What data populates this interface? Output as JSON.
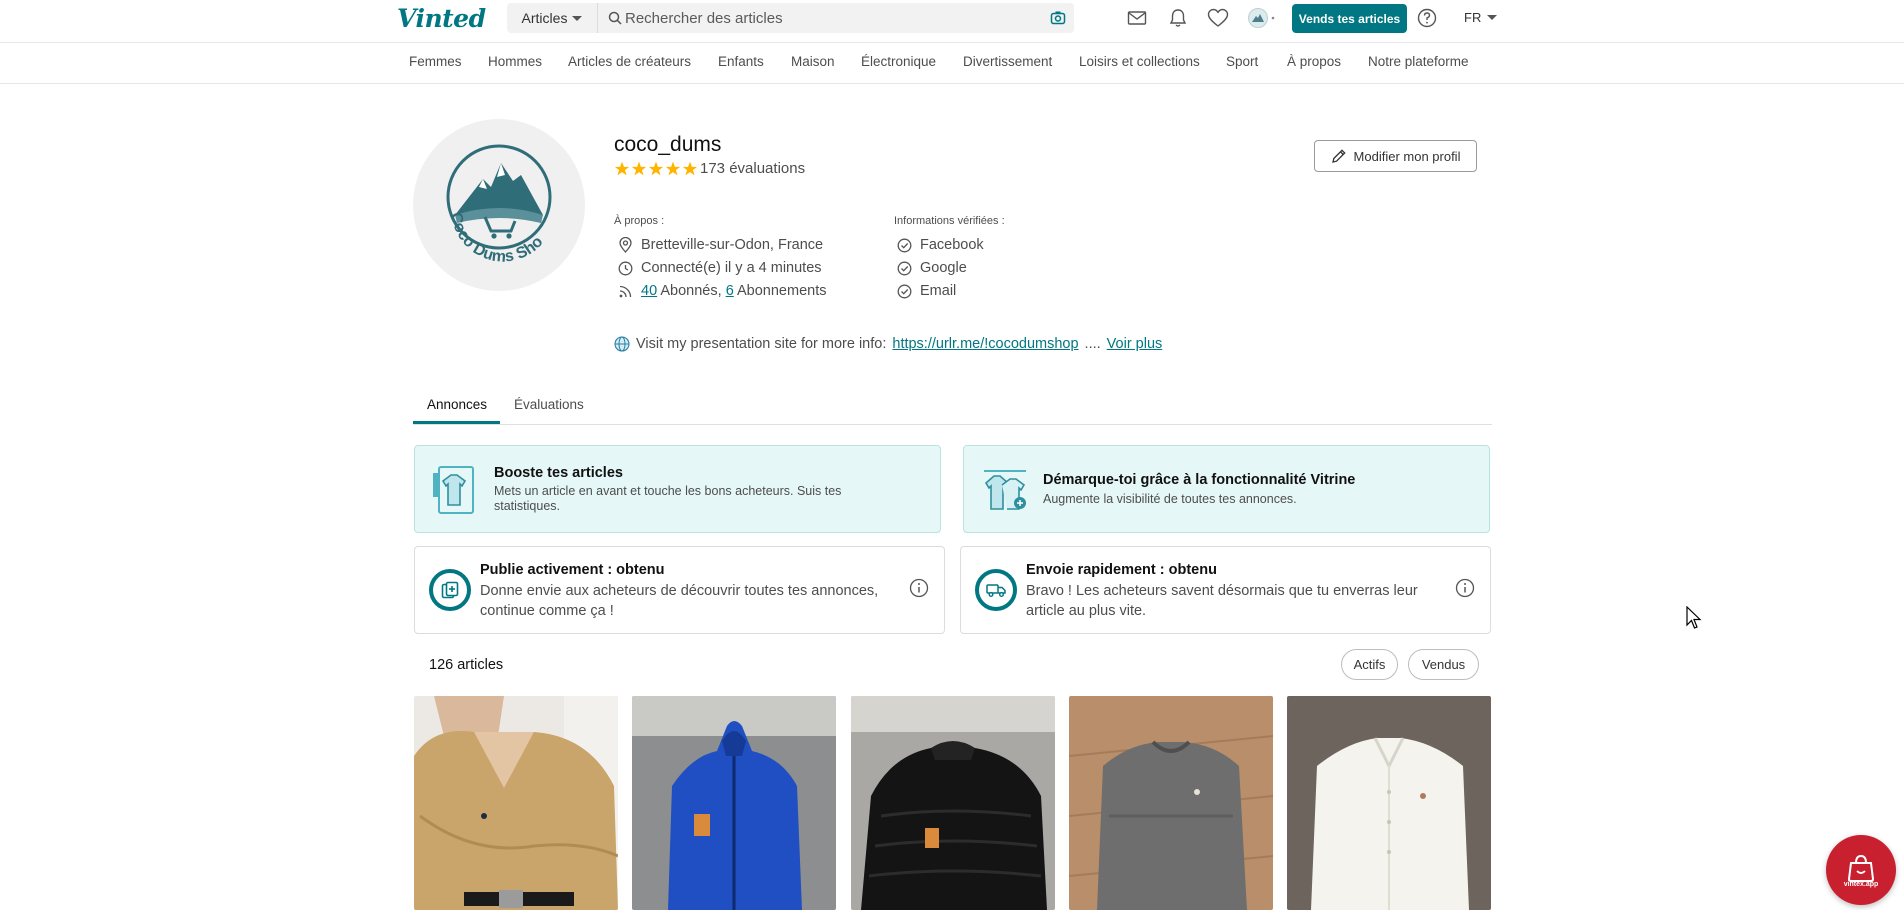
{
  "header": {
    "logo": "Vinted",
    "category_select": "Articles",
    "search_placeholder": "Rechercher des articles",
    "sell_button": "Vends tes articles",
    "language": "FR"
  },
  "nav": {
    "categories": [
      "Femmes",
      "Hommes",
      "Articles de créateurs",
      "Enfants",
      "Maison",
      "Électronique",
      "Divertissement",
      "Loisirs et collections",
      "Sport",
      "À propos",
      "Notre plateforme"
    ]
  },
  "profile": {
    "avatar_text": "Coco Dums Shop",
    "username": "coco_dums",
    "rating_stars": 5,
    "ratings_label": "173 évaluations",
    "edit_button": "Modifier mon profil",
    "about_label": "À propos :",
    "location": "Bretteville-sur-Odon, France",
    "last_seen": "Connecté(e) il y a 4 minutes",
    "followers_count": "40",
    "followers_label": "Abonnés,",
    "following_count": "6",
    "following_label": "Abonnements",
    "verified_label": "Informations vérifiées :",
    "verified": [
      "Facebook",
      "Google",
      "Email"
    ],
    "bio_text": "Visit my presentation site for more info:",
    "bio_link": "https://urlr.me/!cocodumshop",
    "bio_ellipsis": "....",
    "see_more": "Voir plus"
  },
  "tabs": [
    "Annonces",
    "Évaluations"
  ],
  "promos": [
    {
      "title": "Booste tes articles",
      "text": "Mets un article en avant et touche les bons acheteurs. Suis tes statistiques."
    },
    {
      "title": "Démarque-toi grâce à la fonctionnalité Vitrine",
      "text": "Augmente la visibilité de toutes tes annonces."
    }
  ],
  "badges": [
    {
      "title": "Publie activement : obtenu",
      "text": "Donne envie aux acheteurs de découvrir toutes tes annonces, continue comme ça !"
    },
    {
      "title": "Envoie rapidement : obtenu",
      "text": "Bravo ! Les acheteurs savent désormais que tu enverras leur article au plus vite."
    }
  ],
  "items": {
    "count_label": "126 articles",
    "filters": [
      "Actifs",
      "Vendus"
    ]
  },
  "widget": {
    "label": "vintex.app"
  },
  "colors": {
    "brand": "#007782",
    "star": "#ffb400",
    "widget": "#c8202f",
    "promo_bg": "#e6f7f7"
  }
}
